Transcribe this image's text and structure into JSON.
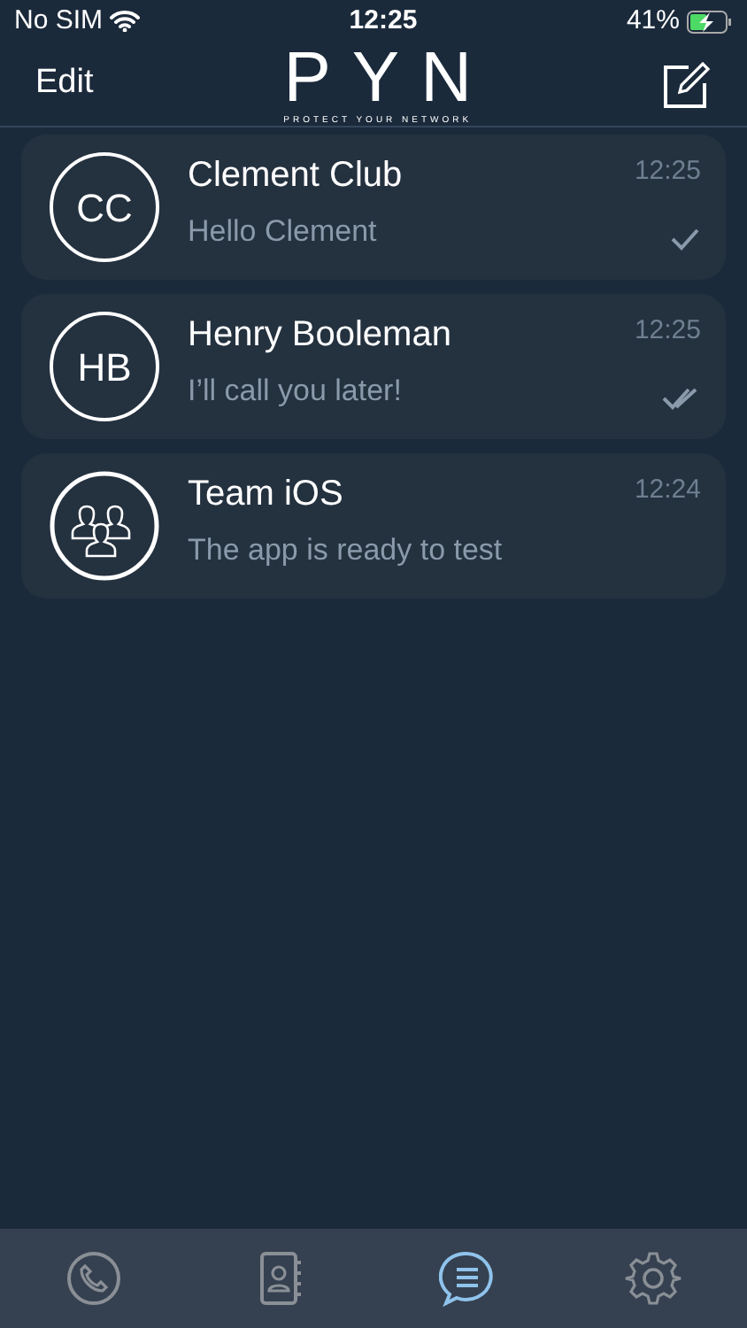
{
  "status_bar": {
    "carrier": "No SIM",
    "time": "12:25",
    "battery": "41%",
    "charging": true
  },
  "nav": {
    "left": "Edit",
    "logo": "PYN",
    "tagline": "PROTECT YOUR NETWORK"
  },
  "chats": [
    {
      "avatar": {
        "kind": "initials",
        "text": "CC"
      },
      "name": "Clement Club",
      "message": "Hello Clement",
      "time": "12:25",
      "sent": true,
      "read": false
    },
    {
      "avatar": {
        "kind": "initials",
        "text": "HB"
      },
      "name": "Henry Booleman",
      "message": "I’ll call you later!",
      "time": "12:25",
      "sent": true,
      "read": true
    },
    {
      "avatar": {
        "kind": "group"
      },
      "name": "Team iOS",
      "message": "The app is ready to test",
      "time": "12:24",
      "sent": false,
      "read": false
    }
  ],
  "tabs": [
    {
      "kind": "calls",
      "selected": false
    },
    {
      "kind": "contacts",
      "selected": false
    },
    {
      "kind": "chats",
      "selected": true
    },
    {
      "kind": "settings",
      "selected": false
    }
  ]
}
